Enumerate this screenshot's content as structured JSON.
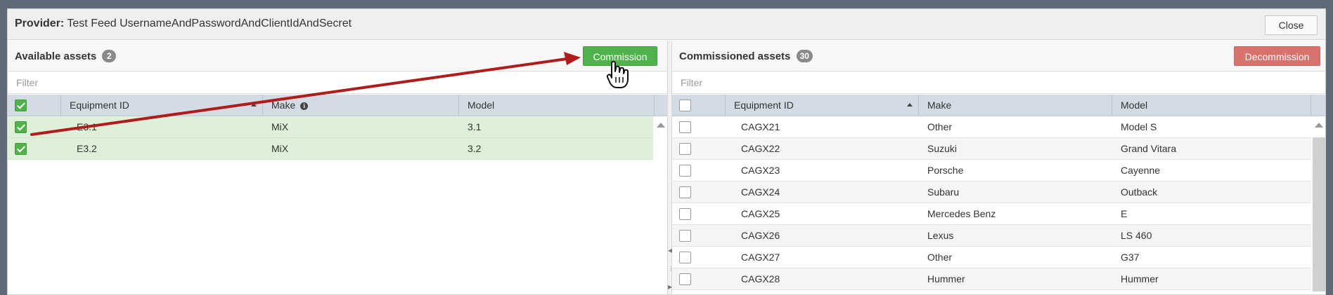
{
  "dialog": {
    "title_prefix": "Provider:",
    "title_name": "Test Feed UsernameAndPasswordAndClientIdAndSecret",
    "close_label": "Close"
  },
  "available": {
    "title": "Available assets",
    "count": "2",
    "commission_label": "Commission",
    "filter_placeholder": "Filter",
    "columns": [
      "Equipment ID",
      "Make",
      "Model"
    ],
    "rows": [
      {
        "id": "E3.1",
        "make": "MiX",
        "model": "3.1",
        "checked": true
      },
      {
        "id": "E3.2",
        "make": "MiX",
        "model": "3.2",
        "checked": true
      }
    ]
  },
  "commissioned": {
    "title": "Commissioned assets",
    "count": "30",
    "decommission_label": "Decommission",
    "filter_placeholder": "Filter",
    "columns": [
      "Equipment ID",
      "Make",
      "Model"
    ],
    "rows": [
      {
        "id": "CAGX21",
        "make": "Other",
        "model": "Model S"
      },
      {
        "id": "CAGX22",
        "make": "Suzuki",
        "model": "Grand Vitara"
      },
      {
        "id": "CAGX23",
        "make": "Porsche",
        "model": "Cayenne"
      },
      {
        "id": "CAGX24",
        "make": "Subaru",
        "model": "Outback"
      },
      {
        "id": "CAGX25",
        "make": "Mercedes Benz",
        "model": "E"
      },
      {
        "id": "CAGX26",
        "make": "Lexus",
        "model": "LS 460"
      },
      {
        "id": "CAGX27",
        "make": "Other",
        "model": "G37"
      },
      {
        "id": "CAGX28",
        "make": "Hummer",
        "model": "Hummer"
      }
    ]
  },
  "colors": {
    "commission": "#4fb24b",
    "decommission": "#d9726d",
    "header_bg": "#d3dce4",
    "selected_row": "#dff0d8",
    "annotation_arrow": "#b01c1c"
  },
  "icons": [
    "info-icon",
    "sort-ascending-icon",
    "hand-pointer-cursor-icon",
    "checkbox-checked-icon",
    "checkbox-unchecked-icon"
  ]
}
